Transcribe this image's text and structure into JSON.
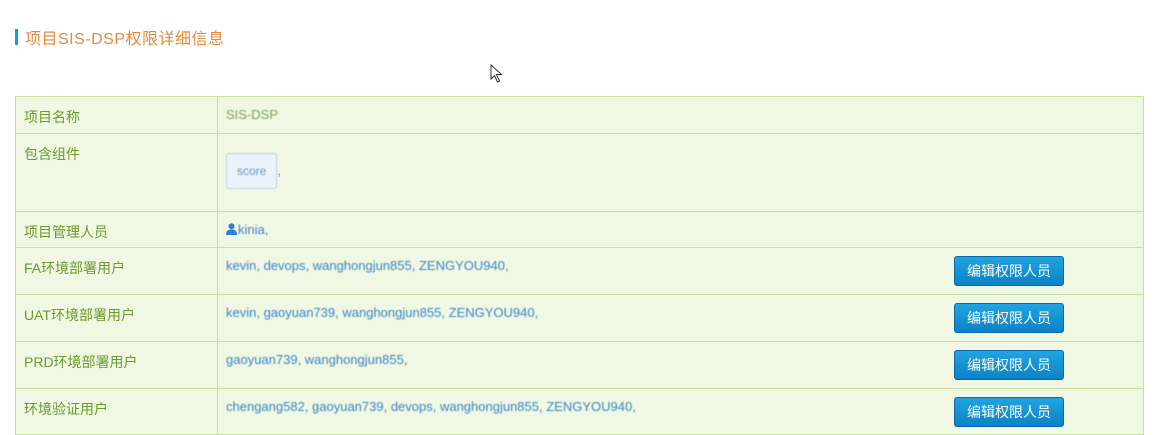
{
  "page": {
    "title": "项目SIS-DSP权限详细信息"
  },
  "table": {
    "rows": {
      "project_name": {
        "label": "项目名称",
        "value": "SIS-DSP"
      },
      "components": {
        "label": "包含组件",
        "tags": [
          "score"
        ],
        "separator": ","
      },
      "managers": {
        "label": "项目管理人员",
        "value": "kinia,"
      },
      "fa_users": {
        "label": "FA环境部署用户",
        "value": "kevin, devops, wanghongjun855, ZENGYOU940,"
      },
      "uat_users": {
        "label": "UAT环境部署用户",
        "value": "kevin, gaoyuan739, wanghongjun855, ZENGYOU940,"
      },
      "prd_users": {
        "label": "PRD环境部署用户",
        "value": "gaoyuan739, wanghongjun855,"
      },
      "verify_users": {
        "label": "环境验证用户",
        "value": "chengang582, gaoyuan739, devops, wanghongjun855, ZENGYOU940,"
      }
    },
    "edit_button_label": "编辑权限人员"
  },
  "icons": {
    "manager_icon": "person-icon",
    "pointer": "mouse-cursor-icon"
  },
  "colors": {
    "title_accent_bar": "#1a9ad6",
    "title_text": "#e58a3a",
    "table_bg": "#f0f8e4",
    "table_border": "#c9df9f",
    "label_text": "#6b9a2a",
    "value_text": "#3a85c6",
    "button_bg": "#0b82c6"
  }
}
